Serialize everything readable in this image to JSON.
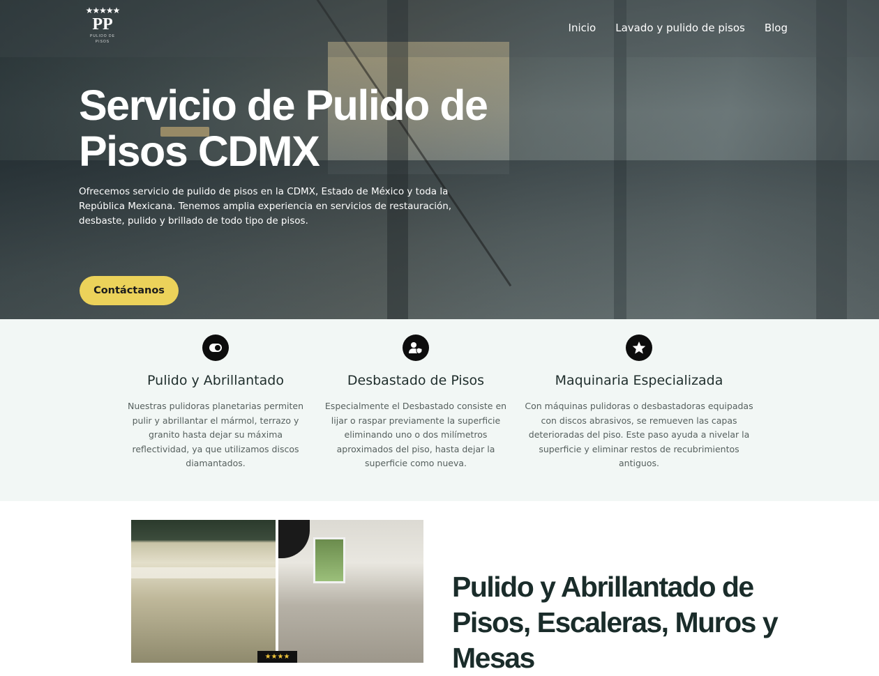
{
  "header": {
    "logo_letters": "PP",
    "logo_stars": "★★★★★",
    "logo_ring_text": "PULIDO DE PISOS",
    "nav": [
      {
        "label": "Inicio"
      },
      {
        "label": "Lavado y pulido de pisos"
      },
      {
        "label": "Blog"
      }
    ]
  },
  "hero": {
    "title": "Servicio de Pulido de Pisos CDMX",
    "description": "Ofrecemos servicio de pulido de pisos en la CDMX, Estado de México y toda la República Mexicana.  Tenemos amplia experiencia en servicios de restauración, desbaste, pulido y brillado de todo tipo de pisos.",
    "cta_label": "Contáctanos",
    "cta_color": "#ecd25a"
  },
  "features": [
    {
      "icon": "toggle-icon",
      "title": "Pulido y Abrillantado",
      "text": "Nuestras pulidoras planetarias permiten pulir y abrillantar el mármol, terrazo y granito hasta dejar su máxima reflectividad, ya que utilizamos discos diamantados."
    },
    {
      "icon": "user-shield-icon",
      "title": "Desbastado de Pisos",
      "text": "Especialmente el Desbastado consiste en lijar o raspar previamente la superficie eliminando uno o dos milímetros aproximados del piso, hasta dejar la superficie como nueva."
    },
    {
      "icon": "star-icon",
      "title": "Maquinaria Especializada",
      "text": "Con máquinas pulidoras o desbastadoras equipadas con discos abrasivos, se remueven las capas deterioradas del piso. Este paso ayuda a nivelar la superficie y eliminar restos de recubrimientos antiguos."
    }
  ],
  "section2": {
    "title": "Pulido y Abrillantado de Pisos, Escaleras, Muros y Mesas",
    "badge_stars": "★★★★"
  },
  "colors": {
    "features_bg": "#f2f7f5",
    "heading_dark": "#1a2c2a"
  }
}
